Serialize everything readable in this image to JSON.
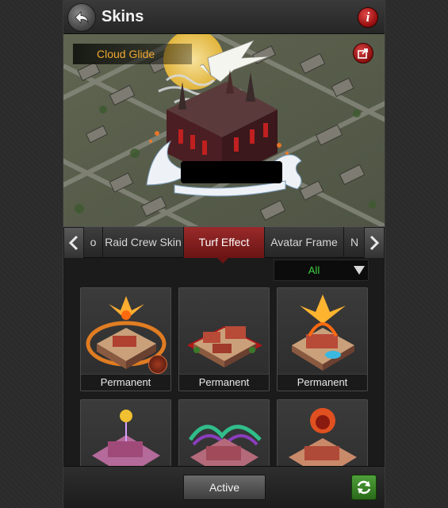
{
  "header": {
    "title": "Skins",
    "back_icon": "back-arrow-icon",
    "info_icon": "info-icon",
    "info_glyph": "i"
  },
  "preview": {
    "skin_name": "Cloud Glide",
    "share_icon": "share-icon"
  },
  "tabs": {
    "items": [
      {
        "label": "o"
      },
      {
        "label": "Raid Crew Skin"
      },
      {
        "label": "Turf Effect",
        "active": true
      },
      {
        "label": "Avatar Frame"
      },
      {
        "label": "N"
      }
    ],
    "left_icon": "chevron-left-icon",
    "right_icon": "chevron-right-icon"
  },
  "filter": {
    "value": "All",
    "icon": "dropdown-caret-icon"
  },
  "skins": [
    {
      "label": "Permanent",
      "effect": "phoenix-fire-ring",
      "badge": "skill-badge-icon"
    },
    {
      "label": "Permanent",
      "effect": "red-carpet-base"
    },
    {
      "label": "Permanent",
      "effect": "phoenix-fire-pool"
    },
    {
      "label": "",
      "effect": "purple-orb"
    },
    {
      "label": "",
      "effect": "aurora-neon"
    },
    {
      "label": "",
      "effect": "flaming-lion"
    }
  ],
  "footer": {
    "active_label": "Active",
    "refresh_icon": "refresh-icon"
  },
  "colors": {
    "accent_red": "#8a1c1c",
    "skin_name": "#f0a830",
    "filter_text": "#3fcf3f",
    "refresh_green": "#3f8a2a"
  }
}
